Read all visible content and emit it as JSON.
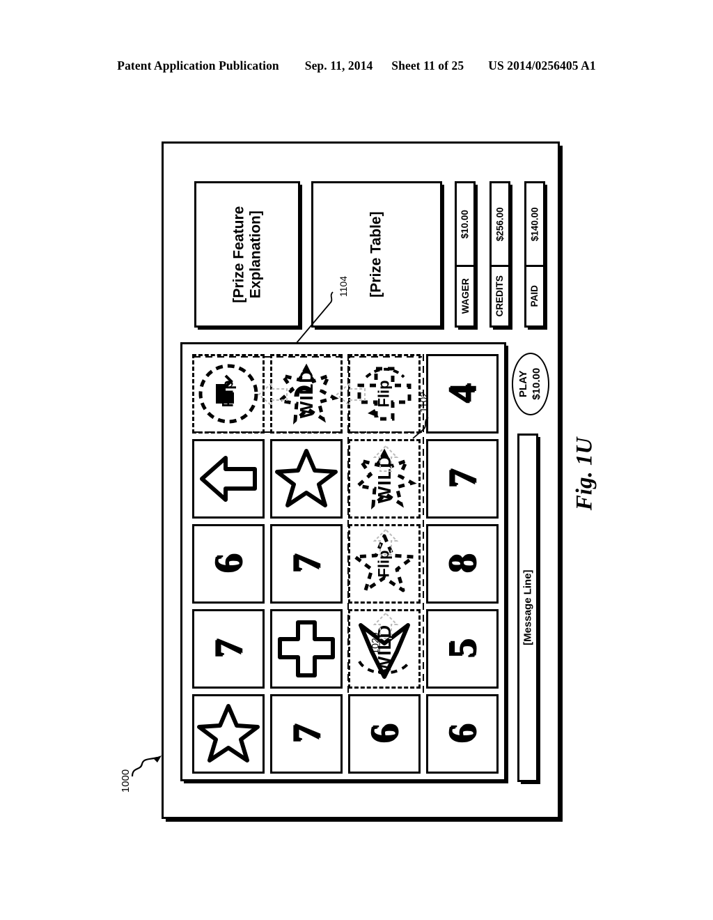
{
  "header": {
    "publication": "Patent Application Publication",
    "date": "Sep. 11, 2014",
    "sheet": "Sheet 11 of 25",
    "docnum": "US 2014/0256405 A1"
  },
  "figure": {
    "label": "Fig. 1U",
    "machine_ref": "1000"
  },
  "panels": {
    "prize_feature_explanation": "[Prize Feature\nExplanation]",
    "prize_table": "[Prize Table]",
    "prize_table_ref": "1104"
  },
  "meters": [
    {
      "label": "WAGER",
      "value": "$10.00"
    },
    {
      "label": "CREDITS",
      "value": "$256.00"
    },
    {
      "label": "PAID",
      "value": "$140.00"
    }
  ],
  "play_button": {
    "line1": "PLAY",
    "line2": "$10.00"
  },
  "message_line": {
    "text": "[Message Line]"
  },
  "reels": {
    "ref_wild_bottom": "1020",
    "ref_four": "1102",
    "columns": [
      {
        "index": 0,
        "cells": [
          {
            "type": "flip",
            "label": "Flip",
            "shape": "circle-dashed",
            "highlight": true
          },
          {
            "type": "arrow",
            "label": "",
            "shape": "arrow",
            "highlight": false
          },
          {
            "type": "num",
            "label": "6",
            "shape": "number",
            "highlight": false
          },
          {
            "type": "num",
            "label": "7",
            "shape": "number",
            "highlight": false
          },
          {
            "type": "star",
            "label": "",
            "shape": "star",
            "highlight": false
          }
        ]
      },
      {
        "index": 1,
        "cells": [
          {
            "type": "wild",
            "label": "WILD",
            "shape": "burst-dashed",
            "highlight": true
          },
          {
            "type": "star",
            "label": "",
            "shape": "star",
            "highlight": false
          },
          {
            "type": "num",
            "label": "7",
            "shape": "number",
            "highlight": false
          },
          {
            "type": "cross",
            "label": "",
            "shape": "cross",
            "highlight": false
          },
          {
            "type": "num",
            "label": "7",
            "shape": "number",
            "highlight": false
          }
        ]
      },
      {
        "index": 2,
        "cells": [
          {
            "type": "flip",
            "label": "Flip",
            "shape": "cross-dashed",
            "highlight": true
          },
          {
            "type": "wild",
            "label": "WILD",
            "shape": "burst-dashed",
            "highlight": true
          },
          {
            "type": "flip",
            "label": "Flip",
            "shape": "star-dashed",
            "highlight": true
          },
          {
            "type": "wild",
            "label": "WILD",
            "shape": "arrow-dashed",
            "highlight": true
          },
          {
            "type": "num",
            "label": "6",
            "shape": "number",
            "highlight": false
          }
        ]
      },
      {
        "index": 3,
        "cells": [
          {
            "type": "num",
            "label": "4",
            "shape": "number",
            "highlight": false
          },
          {
            "type": "num",
            "label": "7",
            "shape": "number",
            "highlight": false
          },
          {
            "type": "num",
            "label": "8",
            "shape": "number",
            "highlight": false
          },
          {
            "type": "num",
            "label": "5",
            "shape": "number",
            "highlight": false
          },
          {
            "type": "num",
            "label": "6",
            "shape": "number",
            "highlight": false
          }
        ]
      }
    ]
  }
}
